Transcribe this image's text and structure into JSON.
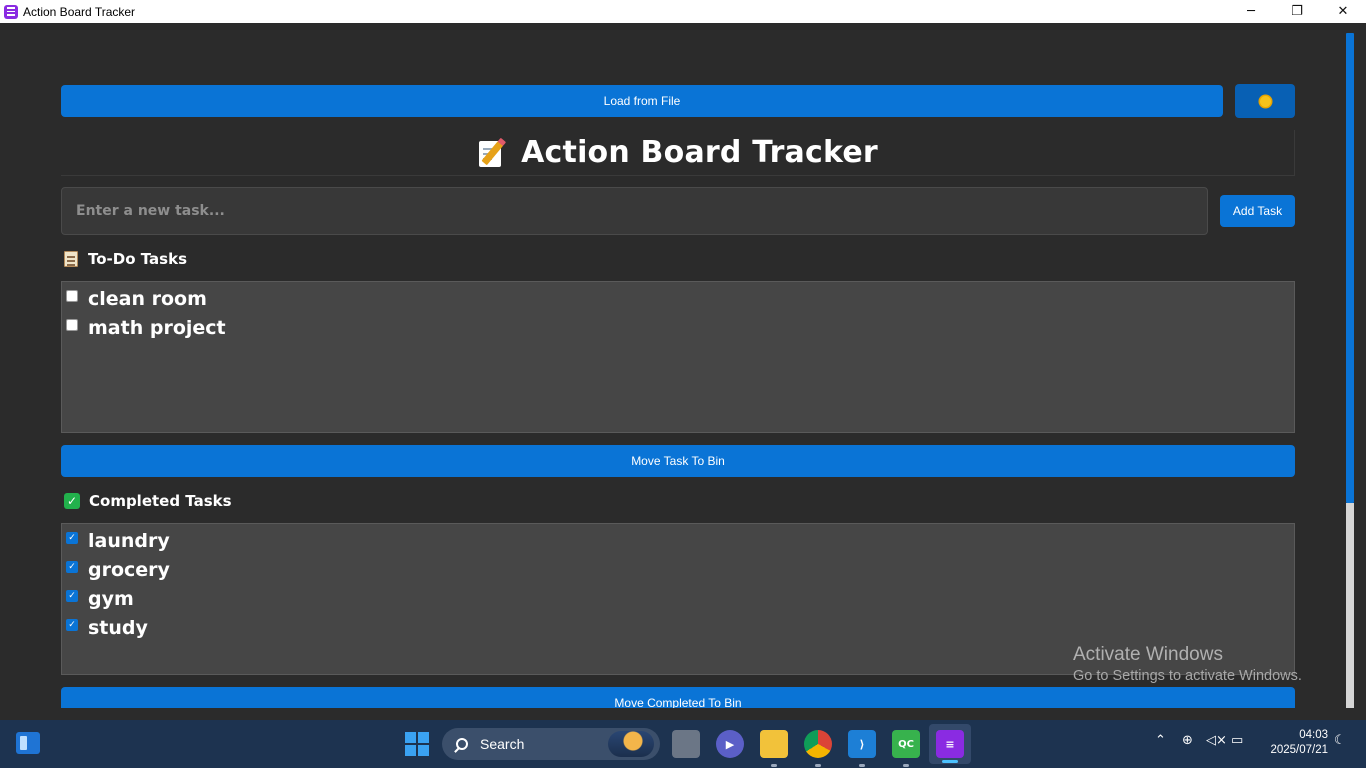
{
  "window": {
    "title": "Action Board Tracker",
    "controls": {
      "minimize": "─",
      "maximize": "❐",
      "close": "✕"
    }
  },
  "toolbar": {
    "load_label": "Load from File",
    "theme_icon": "sun-icon"
  },
  "header": {
    "title": "Action Board Tracker",
    "icon": "memo-icon"
  },
  "input": {
    "placeholder": "Enter a new task...",
    "value": "",
    "add_label": "Add Task"
  },
  "todo": {
    "heading": "To-Do Tasks",
    "icon": "clipboard-icon",
    "items": [
      {
        "text": "clean room",
        "checked": false
      },
      {
        "text": "math project",
        "checked": false
      }
    ],
    "move_label": "Move Task To Bin"
  },
  "completed": {
    "heading": "Completed Tasks",
    "icon": "check-mark-icon",
    "items": [
      {
        "text": "laundry",
        "checked": true
      },
      {
        "text": "grocery",
        "checked": true
      },
      {
        "text": "gym",
        "checked": true
      },
      {
        "text": "study",
        "checked": true
      }
    ],
    "move_label": "Move Completed To Bin"
  },
  "watermark": {
    "line1": "Activate Windows",
    "line2": "Go to Settings to activate Windows."
  },
  "taskbar": {
    "search_label": "Search",
    "time": "04:03",
    "date": "2025/07/21",
    "apps": [
      "task-view-icon",
      "teams-meet-icon",
      "file-explorer-icon",
      "chrome-icon",
      "vscode-icon",
      "qt-creator-icon",
      "action-board-icon"
    ]
  },
  "colors": {
    "accent": "#0a74d6",
    "background": "#2b2b2b",
    "list_bg": "#464646",
    "taskbar": "#1d3350"
  }
}
